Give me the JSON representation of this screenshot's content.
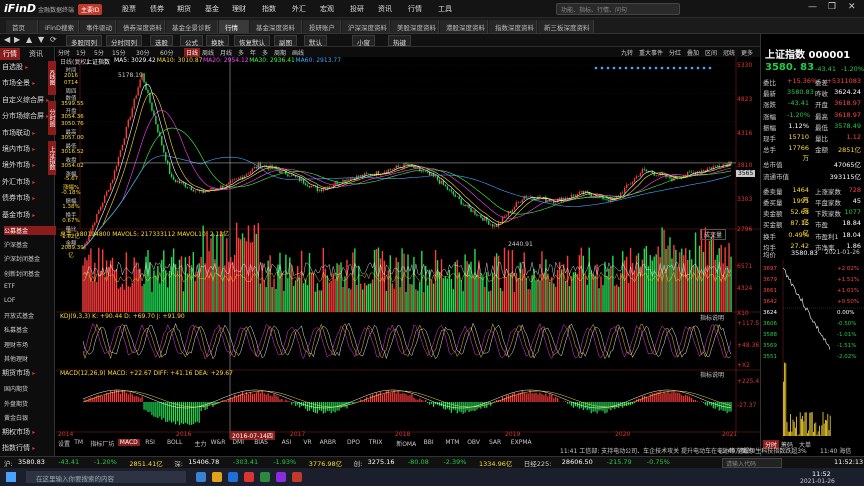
{
  "app": {
    "logo": "iFinD",
    "logo_sub": "金融数据终端",
    "user_badge": "主要ID",
    "menu": [
      "股票",
      "债券",
      "期货",
      "基金",
      "理财",
      "指数",
      "外汇",
      "宏观",
      "投研",
      "资讯",
      "行情",
      "工具"
    ],
    "search_placeholder": "功能、指标、行情、问句",
    "window_controls": [
      "—",
      "❐",
      "✕"
    ]
  },
  "tabs": [
    "首页",
    "iFinD搜索",
    "事件驱动",
    "债券深度资料",
    "基金全景诊断",
    "行情",
    "基金深度资料",
    "投研账户",
    "沪深深度资料",
    "美股深度资料",
    "港股深度资料",
    "指数深度资料",
    "新三板深度资料"
  ],
  "active_tab": "行情",
  "toolbar": [
    "多股同列",
    "分时同列",
    "选股",
    "公式",
    "换肤",
    "恢复默认",
    "副图",
    "默认",
    "小窗",
    "热键"
  ],
  "sidebar": {
    "head": [
      "行情",
      "资讯"
    ],
    "items": [
      {
        "label": "自选股",
        "type": "main"
      },
      {
        "label": "市场全景",
        "type": "main"
      },
      {
        "label": "自定义综合屏",
        "type": "main"
      },
      {
        "label": "分市场综合屏",
        "type": "main"
      },
      {
        "label": "市场联动",
        "type": "main"
      },
      {
        "label": "境内市场",
        "type": "main"
      },
      {
        "label": "境外市场",
        "type": "main"
      },
      {
        "label": "外汇市场",
        "type": "main"
      },
      {
        "label": "债券市场",
        "type": "main"
      },
      {
        "label": "基金市场",
        "type": "main"
      },
      {
        "label": "公募基金",
        "type": "sub"
      },
      {
        "label": "沪深基金",
        "type": "sub"
      },
      {
        "label": "沪深封闭基金",
        "type": "sub"
      },
      {
        "label": "创新封闭基金",
        "type": "sub"
      },
      {
        "label": "ETF",
        "type": "sub"
      },
      {
        "label": "LOF",
        "type": "sub"
      },
      {
        "label": "开放式基金",
        "type": "sub"
      },
      {
        "label": "私募基金",
        "type": "sub"
      },
      {
        "label": "理财市场",
        "type": "sub"
      },
      {
        "label": "其他理财",
        "type": "sub"
      },
      {
        "label": "期货市场",
        "type": "main"
      },
      {
        "label": "国内期货",
        "type": "sub"
      },
      {
        "label": "外盘期货",
        "type": "sub"
      },
      {
        "label": "黄金白银",
        "type": "sub"
      },
      {
        "label": "期权市场",
        "type": "main"
      },
      {
        "label": "指数行情",
        "type": "main"
      }
    ],
    "vtabs": [
      "K线图",
      "分时图",
      "上证指数"
    ]
  },
  "chart_tabs": [
    "分时",
    "1分",
    "5分",
    "15分",
    "30分",
    "60分",
    "日线",
    "周线",
    "月线",
    "多",
    "年",
    "多",
    "周期",
    "画线"
  ],
  "chart_right_tabs": [
    "九转",
    "重大事件",
    "分红",
    "叠加",
    "区间",
    "冠统",
    "更多"
  ],
  "price_panel": {
    "title": "日线(复权)",
    "name": "上证指数",
    "ma_labels": [
      "MA5: 3029.42",
      "MA10: 3010.87",
      "MA20: 2954.12",
      "MA30: 2936.41",
      "MA60: 2913.77"
    ],
    "info_box": [
      "时间",
      "2016",
      "0714",
      "周四",
      "数值",
      "3599.55",
      "开盘",
      "3054.36",
      "3050.76",
      "最高",
      "3057.00",
      "最低",
      "3016.52",
      "收盘",
      "3054.02",
      "涨幅",
      "-5.67",
      "涨幅%",
      "-0.18%",
      "振幅",
      "1.38%",
      "换手",
      "0.67%",
      "量比",
      "1.02亿",
      "金额",
      "2089.39亿"
    ],
    "y_ticks": [
      "5330",
      "4823",
      "4316",
      "3810",
      "3303",
      "2796"
    ],
    "high_label": "5178.19",
    "low_label": "2440.91",
    "current_label": "3565",
    "dropdown": "成交量"
  },
  "vol_panel": {
    "title": "总手: 180194800 MAVOL5: 217333112 MAVOL10: 2.12亿",
    "y_ticks": [
      "6571",
      "4324",
      "X10"
    ]
  },
  "kdj_panel": {
    "title": "KDJ(9,3,3) K: +90.44 D: +69.70 J: +91.90",
    "y_ticks": [
      "+117.5",
      "+48.36",
      "+X2"
    ],
    "label": "指标说明"
  },
  "macd_panel": {
    "title": "MACD(12,26,9) MACD: +22.67 DIFF: +41.16 DEA: +29.67",
    "y_ticks": [
      "+225.4",
      "-27.37"
    ],
    "label": "指标说明"
  },
  "x_ticks": [
    "2014",
    "2016",
    "2016-07-14四",
    "2017",
    "2018",
    "2019",
    "2020",
    "2021"
  ],
  "indicator_tabs": [
    "设置",
    "TM",
    "指标厂坊",
    "MACD",
    "RSI",
    "BOLL",
    "主力",
    "W&R",
    "DMI",
    "BIAS",
    "ASI",
    "VR",
    "ARBR",
    "DPO",
    "TRIX",
    "新OMA",
    "BBI",
    "MTM",
    "OBV",
    "SAR",
    "EXPMA"
  ],
  "active_indicator": "MACD",
  "rpanel": {
    "title": "上证指数 000001",
    "price": "3580. 83",
    "change": "-43.41",
    "change_pct": "-1.20%",
    "rows": [
      {
        "l": "委比",
        "v": "+15.36%",
        "c": "red",
        "l2": "委差",
        "v2": "+5311083",
        "c2": "red"
      },
      {
        "l": "最新",
        "v": "3580.83",
        "c": "green",
        "l2": "昨收",
        "v2": "3624.24",
        "c2": "white"
      },
      {
        "l": "涨跌",
        "v": "-43.41",
        "c": "green",
        "l2": "开盘",
        "v2": "3618.97",
        "c2": "red"
      },
      {
        "l": "涨幅",
        "v": "-1.20%",
        "c": "green",
        "l2": "最高",
        "v2": "3618.97",
        "c2": "red"
      },
      {
        "l": "振幅",
        "v": "1.12%",
        "c": "white",
        "l2": "最低",
        "v2": "3578.49",
        "c2": "green"
      },
      {
        "l": "现手",
        "v": "15710",
        "c": "yellow",
        "l2": "量比",
        "v2": "1.12",
        "c2": "red"
      },
      {
        "l": "总手",
        "v": "17766万",
        "c": "yellow",
        "l2": "金额",
        "v2": "2851亿",
        "c2": "yellow"
      },
      {
        "l": "总市值",
        "v": "",
        "c": "white",
        "l2": "",
        "v2": "47065亿",
        "c2": "white"
      },
      {
        "l": "流通市值",
        "v": "",
        "c": "white",
        "l2": "",
        "v2": "393115亿",
        "c2": "white"
      },
      {
        "l": "委卖量",
        "v": "1464万",
        "c": "yellow",
        "l2": "上涨家数",
        "v2": "728",
        "c2": "red"
      },
      {
        "l": "委买量",
        "v": "1995万",
        "c": "yellow",
        "l2": "平盘家数",
        "v2": "45",
        "c2": "white"
      },
      {
        "l": "卖金额",
        "v": "52.68亿",
        "c": "yellow",
        "l2": "下跌家数",
        "v2": "1077",
        "c2": "green"
      },
      {
        "l": "买金额",
        "v": "87.15亿",
        "c": "yellow",
        "l2": "市盈",
        "v2": "18.84",
        "c2": "white"
      },
      {
        "l": "换手",
        "v": "0.49%",
        "c": "yellow",
        "l2": "市盈利1",
        "v2": "18.04",
        "c2": "white"
      },
      {
        "l": "均手",
        "v": "27.42",
        "c": "yellow",
        "l2": "市净率",
        "v2": "1.86",
        "c2": "white"
      }
    ],
    "mini_header": {
      "l": "均价",
      "v": "3580.83",
      "date": "2021-01-26"
    },
    "mini_ticks": [
      "3697",
      "3679",
      "3661",
      "3642",
      "3624",
      "3606",
      "3588",
      "3569",
      "3551"
    ],
    "mini_ticks_r": [
      "+2.02%",
      "+1.51%",
      "+1.01%",
      "+0.50%",
      "0.00%",
      "-0.50%",
      "-1.01%",
      "-1.51%",
      "-2.02%"
    ],
    "mini_tabs": [
      "分时",
      "筹码",
      "大单"
    ]
  },
  "status": {
    "time_info": "11:41 工信部: 支持电动公司、车企技术攻关 提升电动车在电池等方面的",
    "alert": "11:40 港股恒生科技指数跌超3%",
    "time": "11:40 海信",
    "items": [
      {
        "name": "沪:",
        "v": "3580.83",
        "c": "white"
      },
      {
        "name": "",
        "v": "-43.41",
        "c": "green"
      },
      {
        "name": "",
        "v": "-1.20%",
        "c": "green"
      },
      {
        "name": "",
        "v": "2851.41亿",
        "c": "yellow"
      },
      {
        "name": "深:",
        "v": "15406.78",
        "c": "white"
      },
      {
        "name": "",
        "v": "-303.41",
        "c": "green"
      },
      {
        "name": "",
        "v": "-1.93%",
        "c": "green"
      },
      {
        "name": "",
        "v": "3776.98亿",
        "c": "yellow"
      },
      {
        "name": "创:",
        "v": "3275.16",
        "c": "white"
      },
      {
        "name": "",
        "v": "-80.08",
        "c": "green"
      },
      {
        "name": "",
        "v": "-2.39%",
        "c": "green"
      },
      {
        "name": "",
        "v": "1334.96亿",
        "c": "yellow"
      },
      {
        "name": "日经225:",
        "v": "28606.50",
        "c": "white"
      },
      {
        "name": "",
        "v": "-215.79",
        "c": "green"
      },
      {
        "name": "",
        "v": "-0.75%",
        "c": "green"
      }
    ],
    "search_placeholder": "请输入代码",
    "clock": "11:52:13"
  },
  "taskbar": {
    "search_placeholder": "在这里输入你要搜索的内容",
    "time": "11:52",
    "date": "2021-01-26"
  },
  "chart_data": {
    "type": "line",
    "x": [
      "2014",
      "2015",
      "2016",
      "2017",
      "2018",
      "2019",
      "2020",
      "2021"
    ],
    "series": [
      {
        "values": [
          2050,
          3300,
          5178,
          3300,
          3050,
          3200,
          3550,
          3380,
          3100,
          3300,
          3400,
          3550,
          3300,
          2800,
          2440,
          3000,
          2900,
          3050,
          2900,
          3450,
          3300,
          3450,
          3600
        ]
      }
    ],
    "ylim": [
      2400,
      5330
    ],
    "annotations": [
      "5178.19",
      "2440.91"
    ]
  }
}
